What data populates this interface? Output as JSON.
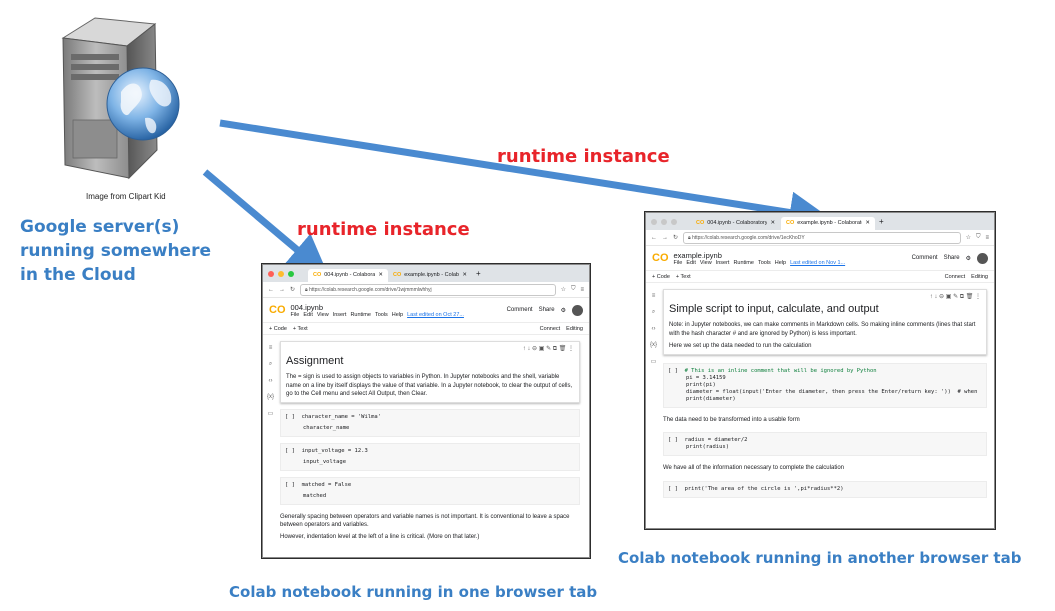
{
  "server": {
    "credit": "Image from Clipart Kid",
    "caption_lines": [
      "Google server(s)",
      "running somewhere",
      "in the Cloud"
    ]
  },
  "arrows": {
    "label_top": "runtime instance",
    "label_left": "runtime instance"
  },
  "captions": {
    "left_window": "Colab notebook running in one browser tab",
    "right_window": "Colab notebook running in another browser tab"
  },
  "colors": {
    "arrow": "#4a8ad0",
    "caption_blue": "#3a7fc4",
    "caption_red": "#e8242a"
  },
  "left_window": {
    "tabs": [
      "004.ipynb - Colaboratory",
      "example.ipynb - Colaboratory"
    ],
    "url": "https://colab.research.google.com/drive/1wjmmmlwhhyj",
    "filename": "004.ipynb",
    "menu": [
      "File",
      "Edit",
      "View",
      "Insert",
      "Runtime",
      "Tools",
      "Help"
    ],
    "last_edited": "Last edited on Oct 27...",
    "comment": "Comment",
    "share": "Share",
    "add_code": "+ Code",
    "add_text": "+ Text",
    "connect": "Connect",
    "editing": "Editing",
    "heading": "Assignment",
    "intro": "The = sign is used to assign objects to variables in Python. In Jupyter notebooks and the shell, variable name on a line by itself displays the value of that variable. In a Jupyter notebook, to clear the output of cells, go to the Cell menu and select All Output, then Clear.",
    "cells": [
      {
        "line1": "character_name = 'Wilma'",
        "line2": "character_name"
      },
      {
        "line1": "input_voltage = 12.3",
        "line2": "input_voltage"
      },
      {
        "line1": "matched = False",
        "line2": "matched"
      }
    ],
    "bracket": "[ ]",
    "footer1": "Generally spacing between operators and variable names is not important. It is conventional to leave a space between operators and variables.",
    "footer2": "However, indentation level at the left of a line is critical. (More on that later.)"
  },
  "right_window": {
    "tabs": [
      "004.ipynb - Colaboratory",
      "example.ipynb - Colaboratory"
    ],
    "url": "https://colab.research.google.com/drive/1ecKhoDY",
    "filename": "example.ipynb",
    "menu": [
      "File",
      "Edit",
      "View",
      "Insert",
      "Runtime",
      "Tools",
      "Help"
    ],
    "last_edited": "Last edited on Nov 1...",
    "comment": "Comment",
    "share": "Share",
    "add_code": "+ Code",
    "add_text": "+ Text",
    "connect": "Connect",
    "editing": "Editing",
    "heading": "Simple script to input, calculate, and output",
    "note": "Note: in Jupyter notebooks, we can make comments in Markdown cells. So making inline comments (lines that start with the hash character # and are ignored by Python) is less important.",
    "setup": "Here we set up the data needed to run the calculation",
    "code1": [
      "# This is an inline comment that will be ignored by Python",
      "pi = 3.14159",
      "print(pi)",
      "diameter = float(input('Enter the diameter, then press the Enter/return key: '))  # when",
      "print(diameter)"
    ],
    "transform": "The data need to be transformed into a usable form",
    "code2": [
      "radius = diameter/2",
      "print(radius)"
    ],
    "complete": "We have all of the information necessary to complete the calculation",
    "code3": "print('The area of the circle is ',pi*radius**2)",
    "bracket": "[ ]"
  }
}
